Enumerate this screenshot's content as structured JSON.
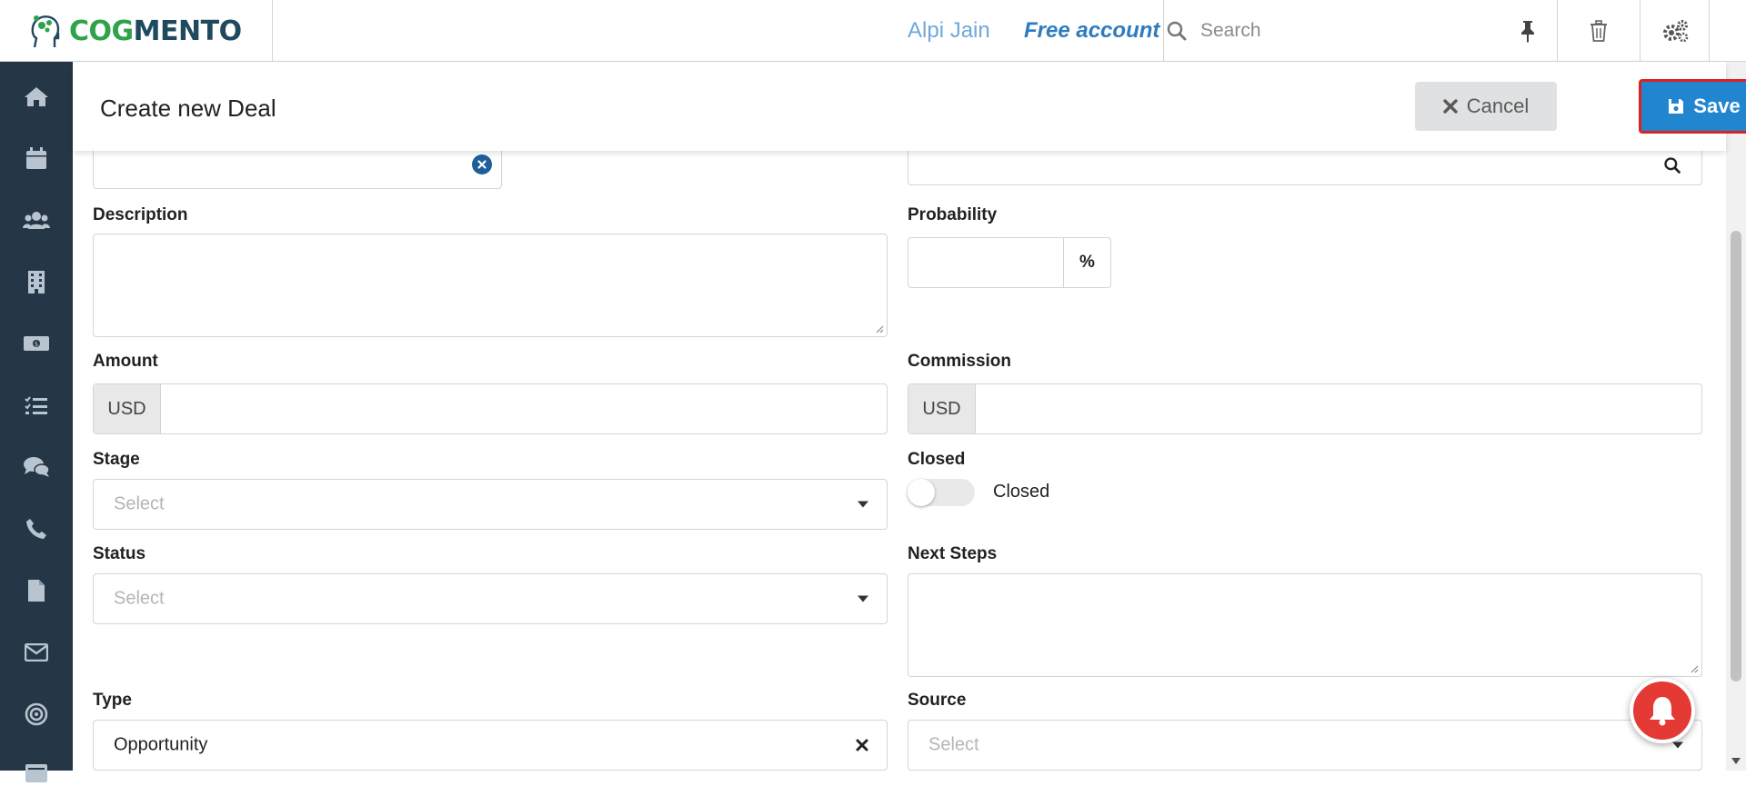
{
  "topbar": {
    "logo": {
      "cog": "COG",
      "mento": "MENTO"
    },
    "user_name": "Alpi Jain",
    "account_type": "Free account",
    "search": {
      "placeholder": "Search",
      "value": ""
    }
  },
  "header": {
    "title": "Create new Deal",
    "cancel_label": "Cancel",
    "save_label": "Save"
  },
  "form": {
    "description": {
      "label": "Description",
      "value": ""
    },
    "probability": {
      "label": "Probability",
      "value": "",
      "suffix": "%"
    },
    "amount": {
      "label": "Amount",
      "currency": "USD",
      "value": ""
    },
    "commission": {
      "label": "Commission",
      "currency": "USD",
      "value": ""
    },
    "stage": {
      "label": "Stage",
      "placeholder": "Select"
    },
    "closed": {
      "label": "Closed",
      "toggle_label": "Closed",
      "checked": false
    },
    "status": {
      "label": "Status",
      "placeholder": "Select"
    },
    "next_steps": {
      "label": "Next Steps",
      "value": ""
    },
    "type": {
      "label": "Type",
      "value": "Opportunity"
    },
    "source": {
      "label": "Source",
      "placeholder": "Select"
    }
  },
  "sidebar": {
    "items": [
      {
        "icon": "home-icon"
      },
      {
        "icon": "calendar-icon"
      },
      {
        "icon": "contacts-icon"
      },
      {
        "icon": "companies-icon"
      },
      {
        "icon": "deals-icon"
      },
      {
        "icon": "tasks-icon"
      },
      {
        "icon": "chat-icon"
      },
      {
        "icon": "phone-icon"
      },
      {
        "icon": "documents-icon"
      },
      {
        "icon": "email-icon"
      },
      {
        "icon": "campaigns-icon"
      },
      {
        "icon": "forms-icon"
      }
    ]
  },
  "colors": {
    "sidebar_bg": "#253746",
    "primary": "#2185d0",
    "danger_outline": "#e02020",
    "bell": "#e53935",
    "brand_green": "#2fa24a",
    "brand_dark": "#1f4a5e"
  }
}
